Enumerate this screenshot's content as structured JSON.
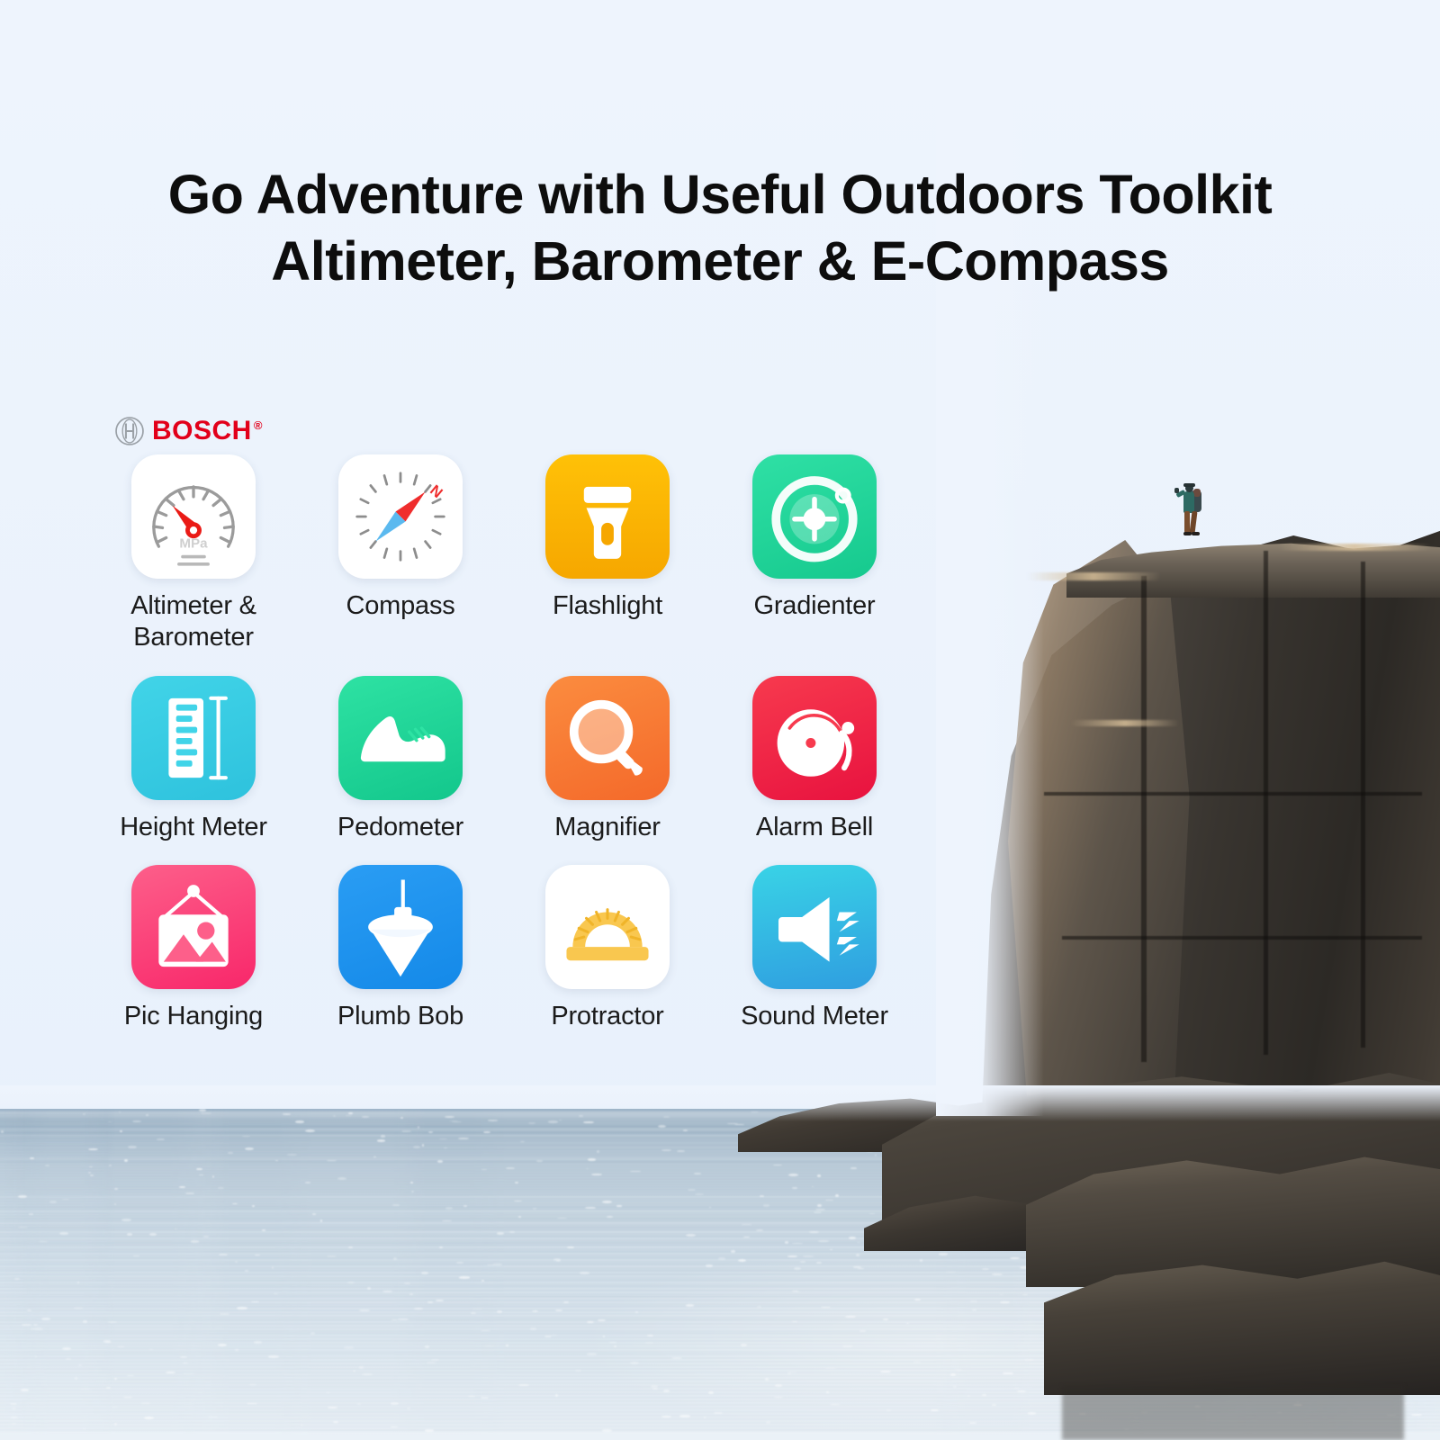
{
  "page": {
    "background_color": "#eef4fd",
    "headline_line1": "Go Adventure with Useful Outdoors Toolkit",
    "headline_line2": "Altimeter, Barometer & E-Compass"
  },
  "brand": {
    "name": "BOSCH",
    "trademark": "®",
    "color": "#e2001a",
    "logo_icon": "bosch-armature-icon"
  },
  "apps": {
    "rows": [
      [
        {
          "label": "Altimeter &\nBarometer",
          "icon": "gauge-barometer-icon",
          "tile_color": "#ffffff",
          "accent": "#e2001a"
        },
        {
          "label": "Compass",
          "icon": "compass-needle-icon",
          "tile_color": "#ffffff",
          "accent": "#ef2d2d"
        },
        {
          "label": "Flashlight",
          "icon": "flashlight-torch-icon",
          "tile_color": "#ffc107",
          "accent": "#ffffff"
        },
        {
          "label": "Gradienter",
          "icon": "bubble-level-target-icon",
          "tile_color": "#2fe0a5",
          "accent": "#ffffff"
        }
      ],
      [
        {
          "label": "Height Meter",
          "icon": "vertical-ruler-icon",
          "tile_color": "#41d4e8",
          "accent": "#ffffff"
        },
        {
          "label": "Pedometer",
          "icon": "running-shoe-icon",
          "tile_color": "#2ee2a3",
          "accent": "#ffffff"
        },
        {
          "label": "Magnifier",
          "icon": "magnifying-glass-icon",
          "tile_color": "#fb8c3f",
          "accent": "#ffffff"
        },
        {
          "label": "Alarm Bell",
          "icon": "alarm-bell-icon",
          "tile_color": "#f73a4e",
          "accent": "#ffffff"
        }
      ],
      [
        {
          "label": "Pic Hanging",
          "icon": "hanging-picture-icon",
          "tile_color": "#fd5f8a",
          "accent": "#ffffff"
        },
        {
          "label": "Plumb Bob",
          "icon": "plumb-bob-icon",
          "tile_color": "#2a9df4",
          "accent": "#ffffff"
        },
        {
          "label": "Protractor",
          "icon": "protractor-icon",
          "tile_color": "#ffffff",
          "accent": "#f8c košice"
        },
        {
          "label": "Sound Meter",
          "icon": "speaker-sound-icon",
          "tile_color": "#39d3e6",
          "accent": "#ffffff"
        }
      ]
    ]
  },
  "photo": {
    "description": "Coastal cliff at sunrise with a hiker standing on the edge and calm rippled sea below",
    "subjects": [
      "hiker-on-cliff",
      "rocky-sea-cliff",
      "ocean-water"
    ],
    "sea_color": "#b9cbda",
    "rock_color": "#3b3630"
  }
}
